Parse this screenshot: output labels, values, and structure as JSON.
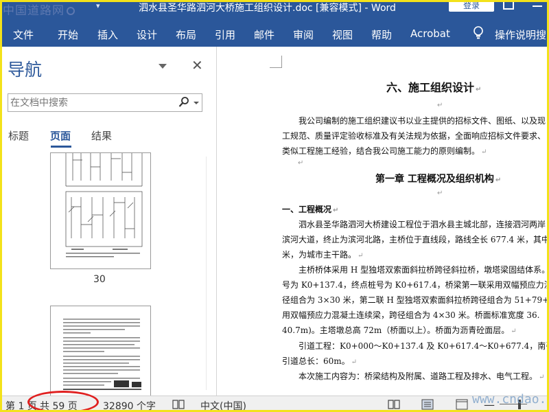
{
  "titlebar": {
    "watermark": "中国道路网",
    "document_title": "泗水县圣华路泗河大桥施工组织设计.doc [兼容模式] - Word",
    "login_label": "登录"
  },
  "menu": {
    "tabs": [
      "文件",
      "开始",
      "插入",
      "设计",
      "布局",
      "引用",
      "邮件",
      "审阅",
      "视图",
      "帮助",
      "Acrobat"
    ],
    "tell_me": "操作说明搜"
  },
  "nav": {
    "title": "导航",
    "search_placeholder": "在文档中搜索",
    "tabs": [
      "标题",
      "页面",
      "结果"
    ],
    "active_tab": "页面",
    "thumb_page_number": "30"
  },
  "document": {
    "lines": [
      {
        "kind": "heading",
        "text": "六、施工组织设计"
      },
      {
        "kind": "para",
        "text": "我公司编制的施工组织建议书以业主提供的招标文件、图纸、以及现"
      },
      {
        "kind": "para",
        "text": "工规范、质量评定验收标准及有关法规为依据，全面响应招标文件要求、"
      },
      {
        "kind": "para",
        "text": "类似工程施工经验，结合我公司施工能力的原则编制。"
      },
      {
        "kind": "heading",
        "text": "第一章  工程概况及组织机构"
      },
      {
        "kind": "subheading",
        "text": "一、工程概况"
      },
      {
        "kind": "para",
        "text": "泗水县圣华路泗河大桥建设工程位于泗水县主城北部，连接泗河两岸"
      },
      {
        "kind": "para",
        "text": "滨河大道，终止为滨河北路，主桥位于直线段，路线全长 677.4 米，其中桥"
      },
      {
        "kind": "para",
        "text": "米，为城市主干路。"
      },
      {
        "kind": "para",
        "text": "主桥桥体采用 H 型独塔双索面斜拉桥跨径斜拉桥，墩塔梁固结体系。"
      },
      {
        "kind": "para",
        "text": "号为 K0+137.4，终点桩号为 K0+617.4，桥梁第一联采用双幅预应力混凝土"
      },
      {
        "kind": "para",
        "text": "径组合为 3×30 米，第二联 H 型独塔双索面斜拉桥跨径组合为 51+79+140m"
      },
      {
        "kind": "para",
        "text": "用双幅预应力混凝土连续梁，跨径组合为 4×30 米。桥面标准宽度 36."
      },
      {
        "kind": "para",
        "text": "40.7m)。主塔墩总高 72m（桥面以上）。桥面为沥青砼面层。"
      },
      {
        "kind": "para",
        "text": "引道工程：K0+000～K0+137.4 及 K0+617.4～K0+677.4，南引道总长："
      },
      {
        "kind": "para",
        "text": "引道总长：60m。"
      },
      {
        "kind": "para",
        "text": "本次施工内容为：桥梁结构及附属、道路工程及排水、电气工程。"
      }
    ]
  },
  "status": {
    "page": "第 1 页",
    "total_pages": "共 59 页",
    "words": "32890 个字",
    "language": "中文(中国)",
    "watermark": "www.cndao.com"
  },
  "colors": {
    "ribbon": "#2b579a",
    "highlight_ellipse": "#e02020",
    "frame": "#f3e21a"
  }
}
